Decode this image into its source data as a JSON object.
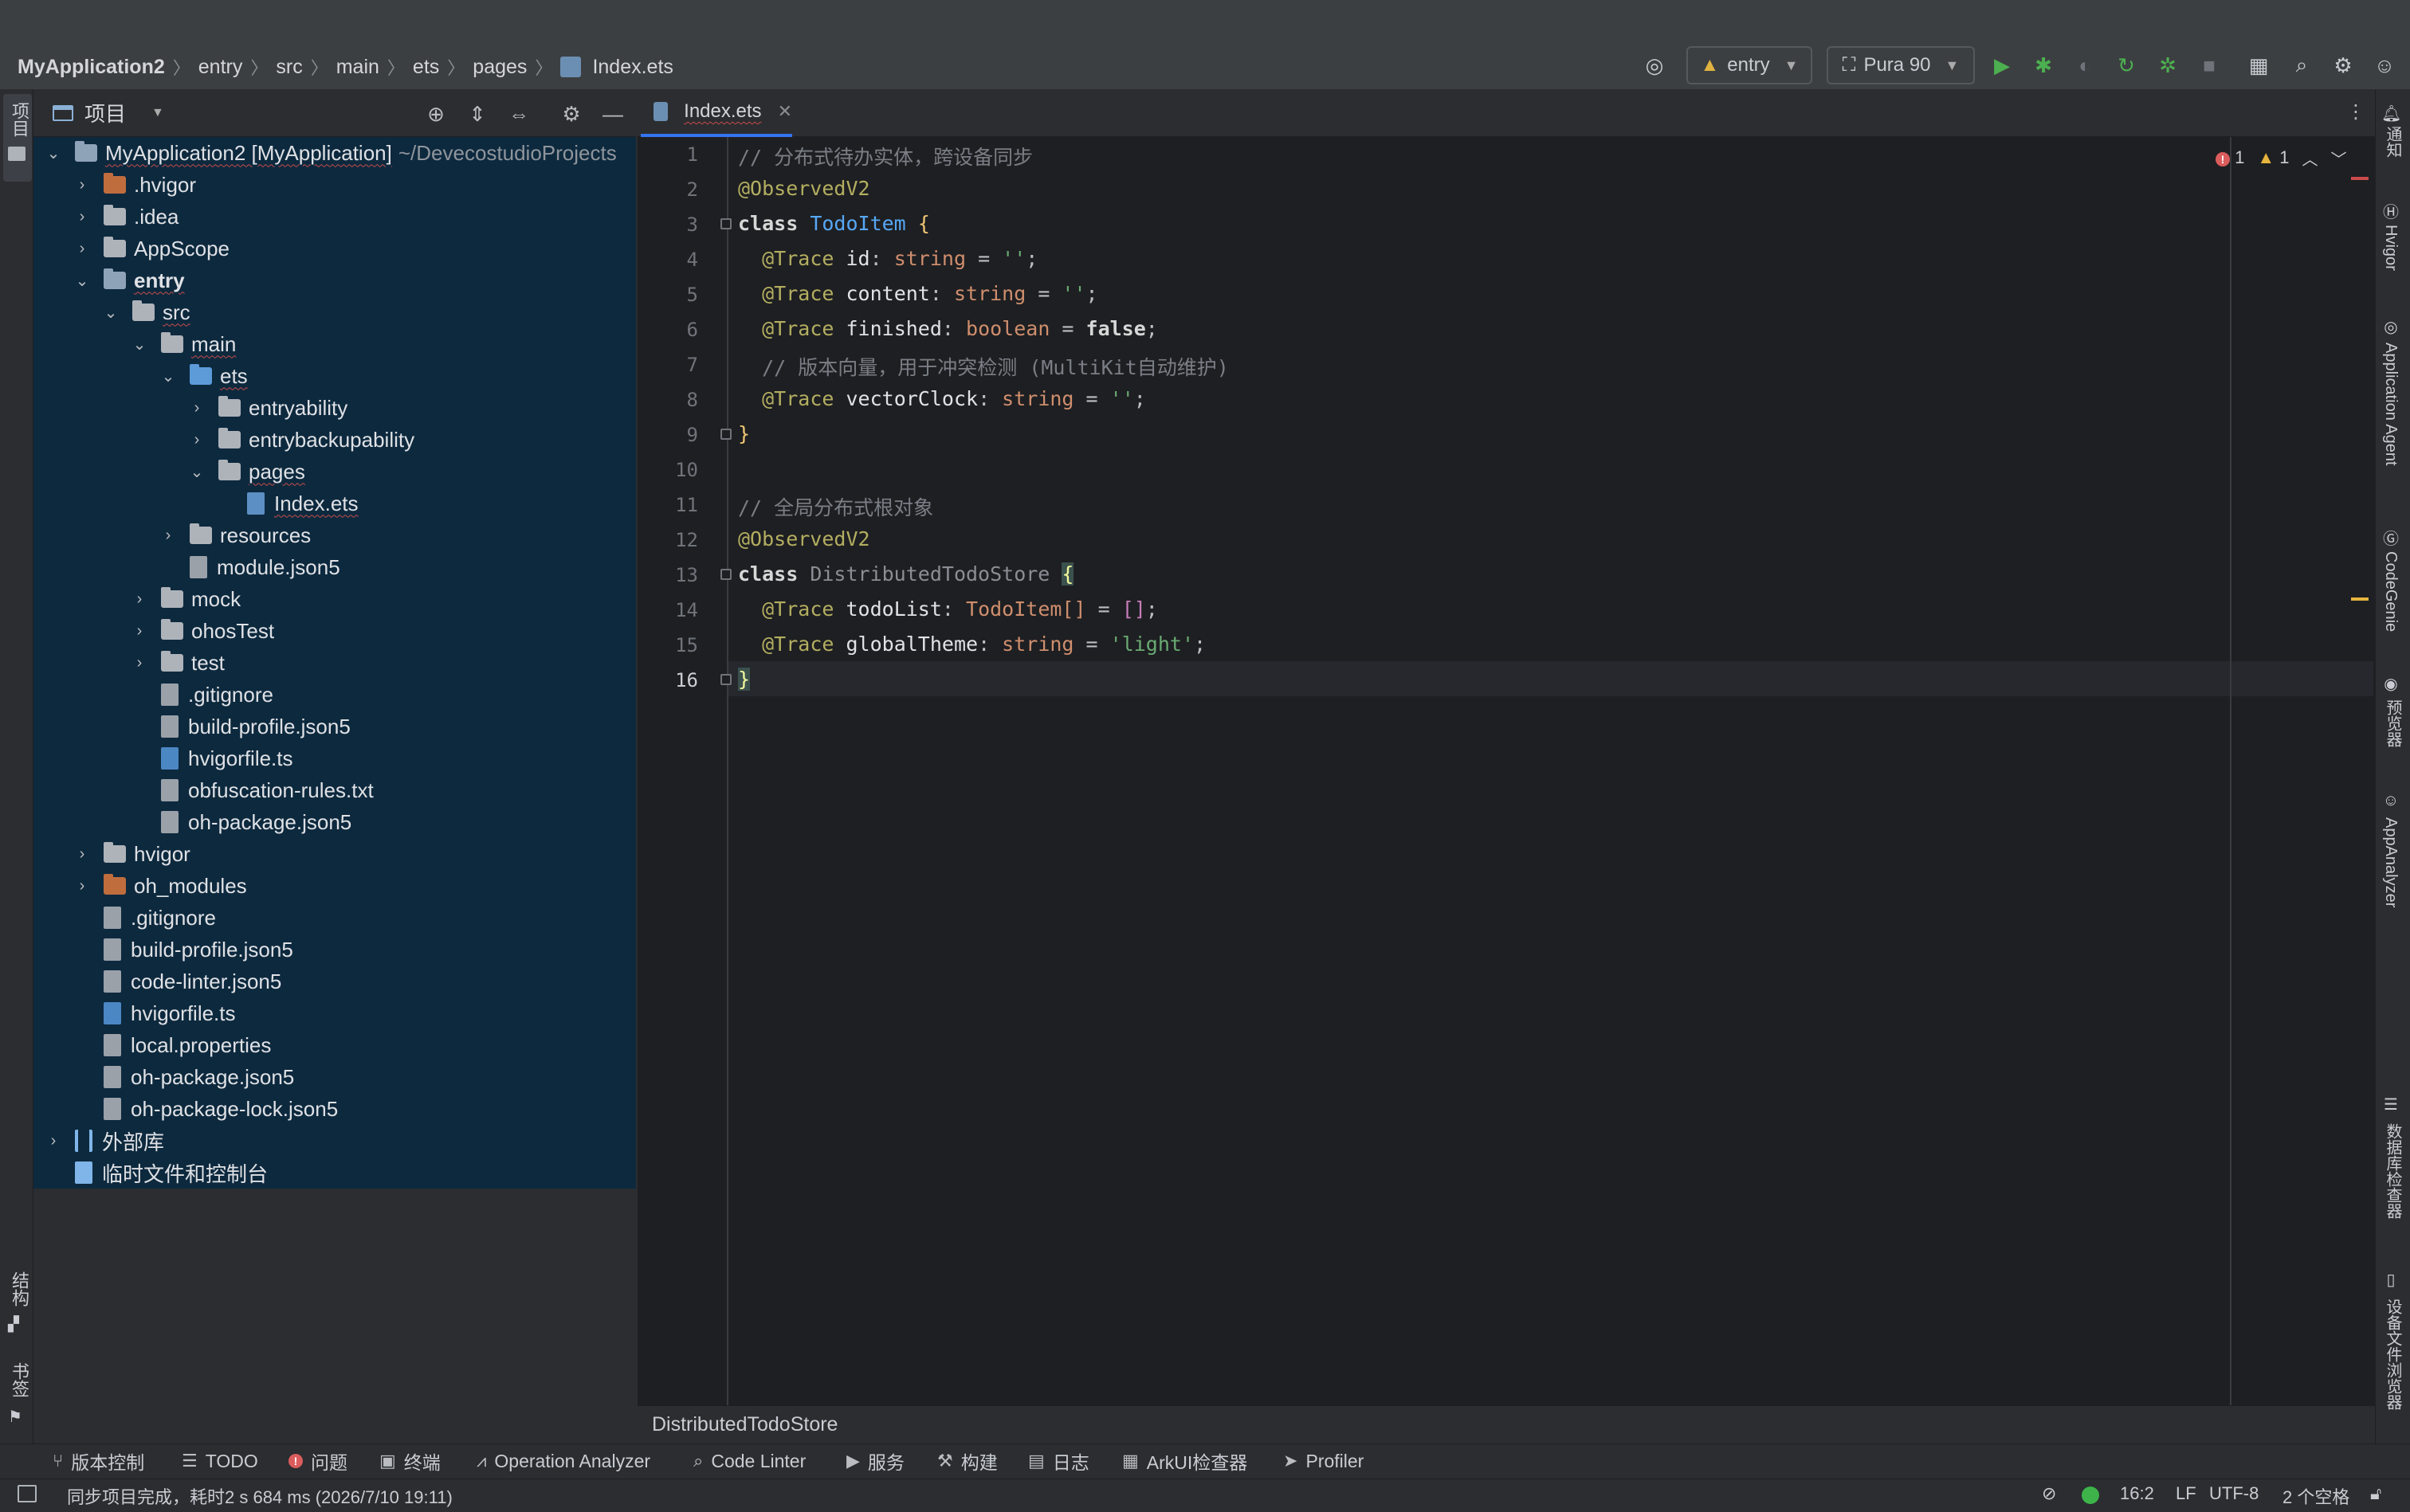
{
  "breadcrumb": [
    "MyApplication2",
    "entry",
    "src",
    "main",
    "ets",
    "pages",
    "Index.ets"
  ],
  "toolbar": {
    "run_config": "entry",
    "device": "Pura 90"
  },
  "project_panel": {
    "title": "项目",
    "tree": [
      {
        "label": "MyApplication2 [MyApplication]",
        "extra": "~/DevecostudioProjects",
        "type": "module-root",
        "expanded": true
      },
      {
        "label": ".hvigor",
        "type": "folder-orange",
        "expanded": false
      },
      {
        "label": ".idea",
        "type": "folder",
        "expanded": false
      },
      {
        "label": "AppScope",
        "type": "folder",
        "expanded": false
      },
      {
        "label": "entry",
        "type": "folder-module",
        "expanded": true
      },
      {
        "label": "src",
        "type": "folder",
        "expanded": true
      },
      {
        "label": "main",
        "type": "folder",
        "expanded": true
      },
      {
        "label": "ets",
        "type": "folder-blue",
        "expanded": true
      },
      {
        "label": "entryability",
        "type": "folder",
        "expanded": false
      },
      {
        "label": "entrybackupability",
        "type": "folder",
        "expanded": false
      },
      {
        "label": "pages",
        "type": "folder",
        "expanded": true
      },
      {
        "label": "Index.ets",
        "type": "file-ets"
      },
      {
        "label": "resources",
        "type": "folder",
        "expanded": false
      },
      {
        "label": "module.json5",
        "type": "file"
      },
      {
        "label": "mock",
        "type": "folder",
        "expanded": false
      },
      {
        "label": "ohosTest",
        "type": "folder",
        "expanded": false
      },
      {
        "label": "test",
        "type": "folder",
        "expanded": false
      },
      {
        "label": ".gitignore",
        "type": "file"
      },
      {
        "label": "build-profile.json5",
        "type": "file"
      },
      {
        "label": "hvigorfile.ts",
        "type": "file-ts"
      },
      {
        "label": "obfuscation-rules.txt",
        "type": "file"
      },
      {
        "label": "oh-package.json5",
        "type": "file"
      },
      {
        "label": "hvigor",
        "type": "folder",
        "expanded": false
      },
      {
        "label": "oh_modules",
        "type": "folder-orange",
        "expanded": false
      },
      {
        "label": ".gitignore",
        "type": "file"
      },
      {
        "label": "build-profile.json5",
        "type": "file"
      },
      {
        "label": "code-linter.json5",
        "type": "file"
      },
      {
        "label": "hvigorfile.ts",
        "type": "file-ts"
      },
      {
        "label": "local.properties",
        "type": "file"
      },
      {
        "label": "oh-package.json5",
        "type": "file"
      },
      {
        "label": "oh-package-lock.json5",
        "type": "file"
      },
      {
        "label": "外部库",
        "type": "library",
        "expanded": false
      },
      {
        "label": "临时文件和控制台",
        "type": "scratch"
      }
    ]
  },
  "editor": {
    "tab_label": "Index.ets",
    "line_numbers": [
      "1",
      "2",
      "3",
      "4",
      "5",
      "6",
      "7",
      "8",
      "9",
      "10",
      "11",
      "12",
      "13",
      "14",
      "15",
      "16"
    ],
    "current_line": "16",
    "errors": "1",
    "warnings": "1",
    "code": {
      "l1": "// 分布式待办实体，跨设备同步",
      "l2": "@ObservedV2",
      "l3_kw": "class",
      "l3_name": "TodoItem",
      "l3_brace": "{",
      "l4_dec": "@Trace",
      "l4_field": "id",
      "l4_type": "string",
      "l4_val": "''",
      "l5_dec": "@Trace",
      "l5_field": "content",
      "l5_type": "string",
      "l5_val": "''",
      "l6_dec": "@Trace",
      "l6_field": "finished",
      "l6_type": "boolean",
      "l6_val": "false",
      "l7": "// 版本向量，用于冲突检测 (MultiKit自动维护)",
      "l8_dec": "@Trace",
      "l8_field": "vectorClock",
      "l8_type": "string",
      "l8_val": "''",
      "l9": "}",
      "l11": "// 全局分布式根对象",
      "l12": "@ObservedV2",
      "l13_kw": "class",
      "l13_name": "DistributedTodoStore",
      "l13_brace": "{",
      "l14_dec": "@Trace",
      "l14_field": "todoList",
      "l14_type": "TodoItem[]",
      "l14_val": "[]",
      "l15_dec": "@Trace",
      "l15_field": "globalTheme",
      "l15_type": "string",
      "l15_val": "'light'",
      "l16": "}"
    },
    "breadcrumb": "DistributedTodoStore"
  },
  "left_strip": {
    "top": "项目",
    "structure": "结构",
    "bookmarks": "书签"
  },
  "right_strip": [
    "通知",
    "Hvigor",
    "Application Agent",
    "CodeGenie",
    "预览器",
    "AppAnalyzer",
    "数据库检查器",
    "设备文件浏览器"
  ],
  "tool_windows": [
    "版本控制",
    "TODO",
    "问题",
    "终端",
    "Operation Analyzer",
    "Code Linter",
    "服务",
    "构建",
    "日志",
    "ArkUI检查器",
    "Profiler"
  ],
  "status": {
    "message": "同步项目完成，耗时2 s 684 ms (2026/7/10 19:11)",
    "position": "16:2",
    "line_sep": "LF",
    "encoding": "UTF-8",
    "indent": "2 个空格"
  }
}
